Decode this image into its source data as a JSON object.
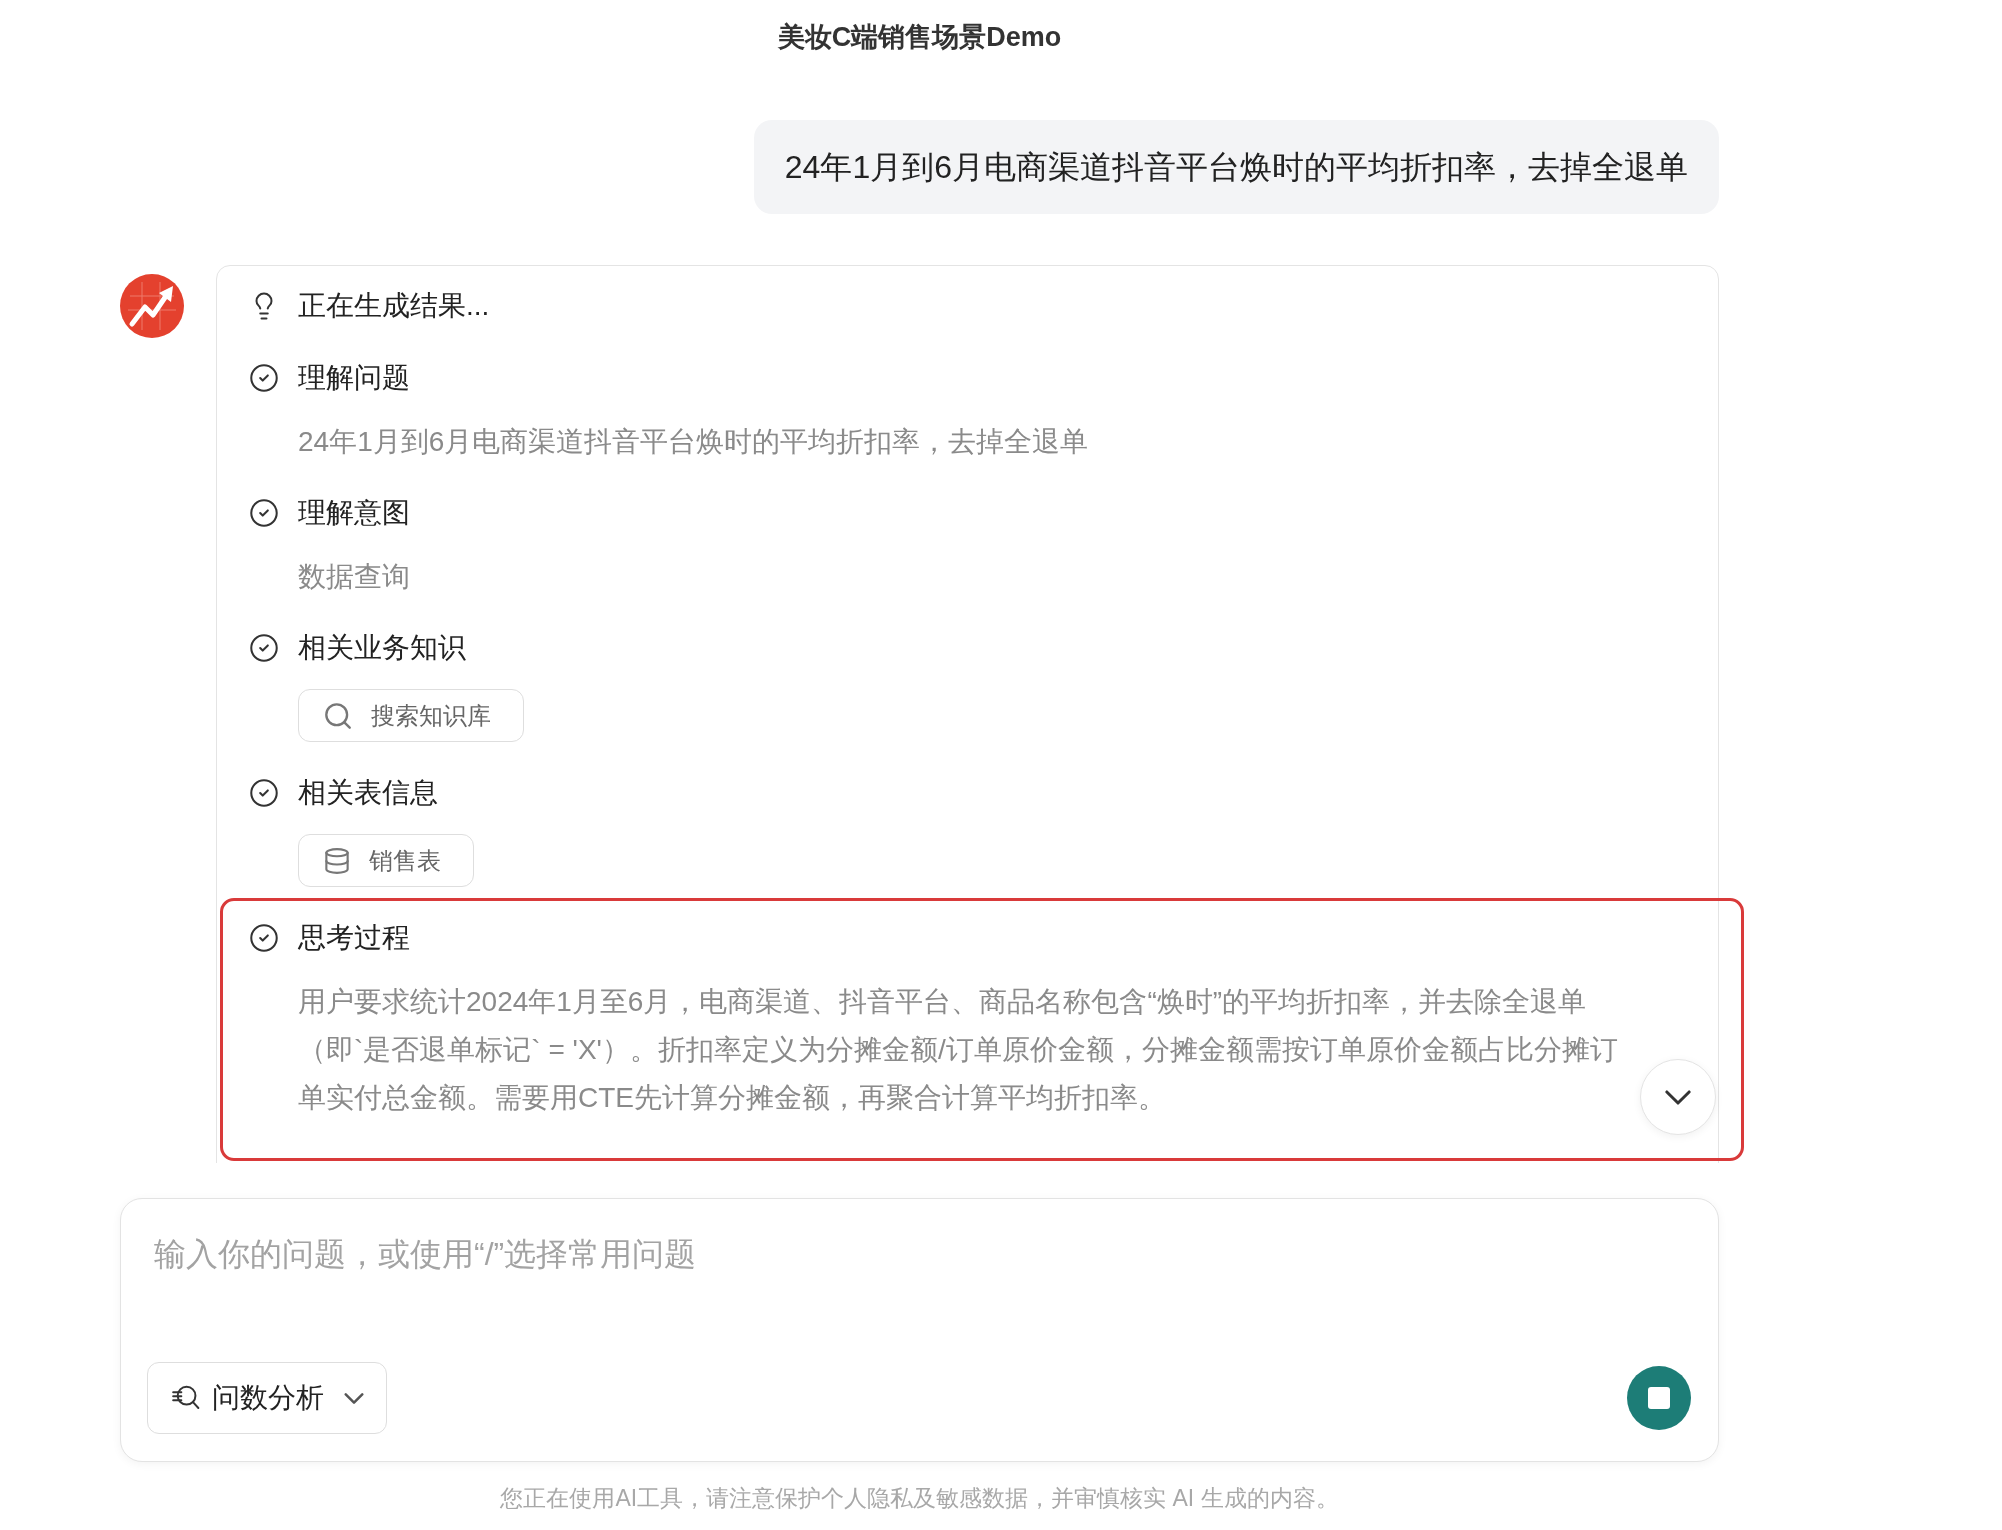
{
  "header": {
    "title": "美妆C端销售场景Demo"
  },
  "user_message": {
    "text": "24年1月到6月电商渠道抖音平台焕时的平均折扣率，去掉全退单"
  },
  "assistant": {
    "status": "正在生成结果...",
    "steps": [
      {
        "title": "理解问题",
        "done": true,
        "highlighted": false,
        "kind": "text",
        "content": "24年1月到6月电商渠道抖音平台焕时的平均折扣率，去掉全退单"
      },
      {
        "title": "理解意图",
        "done": true,
        "highlighted": false,
        "kind": "text",
        "content": "数据查询"
      },
      {
        "title": "相关业务知识",
        "done": true,
        "highlighted": false,
        "kind": "search",
        "content": "搜索知识库"
      },
      {
        "title": "相关表信息",
        "done": true,
        "highlighted": false,
        "kind": "table",
        "content": "销售表"
      },
      {
        "title": "思考过程",
        "done": true,
        "highlighted": true,
        "kind": "text",
        "content": "用户要求统计2024年1月至6月，电商渠道、抖音平台、商品名称包含“焕时”的平均折扣率，并去除全退单（即`是否退单标记` = 'X'）。折扣率定义为分摊金额/订单原价金额，分摊金额需按订单原价金额占比分摊订单实付总金额。需要用CTE先计算分摊金额，再聚合计算平均折扣率。"
      }
    ]
  },
  "composer": {
    "placeholder": "输入你的问题，或使用“/”选择常用问题",
    "mode_button": "问数分析"
  },
  "disclaimer": "您正在使用AI工具，请注意保护个人隐私及敏感数据，并审慎核实 AI 生成的内容。"
}
